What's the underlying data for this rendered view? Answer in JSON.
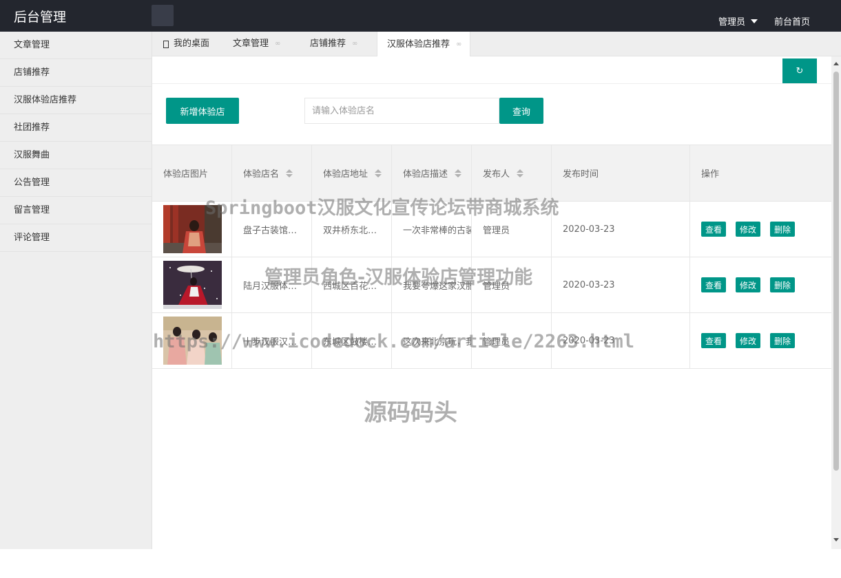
{
  "header": {
    "title": "后台管理",
    "toggle_icon": "",
    "admin_label": "管理员",
    "front_link": "前台首页"
  },
  "sidebar": {
    "items": [
      {
        "label": "文章管理"
      },
      {
        "label": "店铺推荐"
      },
      {
        "label": "汉服体验店推荐"
      },
      {
        "label": "社团推荐"
      },
      {
        "label": "汉服舞曲"
      },
      {
        "label": "公告管理"
      },
      {
        "label": "留言管理"
      },
      {
        "label": "评论管理"
      }
    ]
  },
  "tabs": [
    {
      "label": "我的桌面"
    },
    {
      "label": "文章管理"
    },
    {
      "label": "店铺推荐"
    },
    {
      "label": "汉服体验店推荐"
    }
  ],
  "tab_close_glyph": "∞",
  "toolbar": {
    "refresh_icon": "↻",
    "add_label": "新增体验店",
    "search_placeholder": "请输入体验店名",
    "search_label": "查询"
  },
  "table": {
    "columns": [
      "体验店图片",
      "体验店名",
      "体验店地址",
      "体验店描述",
      "发布人",
      "发布时间",
      "操作"
    ],
    "rows": [
      {
        "name": "盘子古装馆…",
        "address": "双井桥东北…",
        "desc": "一次非常棒的古装",
        "publisher": "管理员",
        "date": "2020-03-23"
      },
      {
        "name": "陆月汉服体…",
        "address": "西城区百花…",
        "desc": "我要夸爆这家汉服",
        "publisher": "管理员",
        "date": "2020-03-23"
      },
      {
        "name": "十步汉服汉…",
        "address": "东城区鼓楼…",
        "desc": "这次来北京玩，我",
        "publisher": "管理员",
        "date": "2020-03-23"
      }
    ],
    "actions": {
      "view": "查看",
      "edit": "修改",
      "delete": "删除"
    }
  },
  "watermarks": {
    "line1": "Springboot汉服文化宣传论坛带商城系统",
    "line2": "管理员角色-汉服体验店管理功能",
    "line3": "https://www.icodedock.com/article/2263.html",
    "line4": "源码码头"
  },
  "colors": {
    "accent": "#009688",
    "header_bg": "#23262e",
    "sidebar_bg": "#eeeeee"
  }
}
